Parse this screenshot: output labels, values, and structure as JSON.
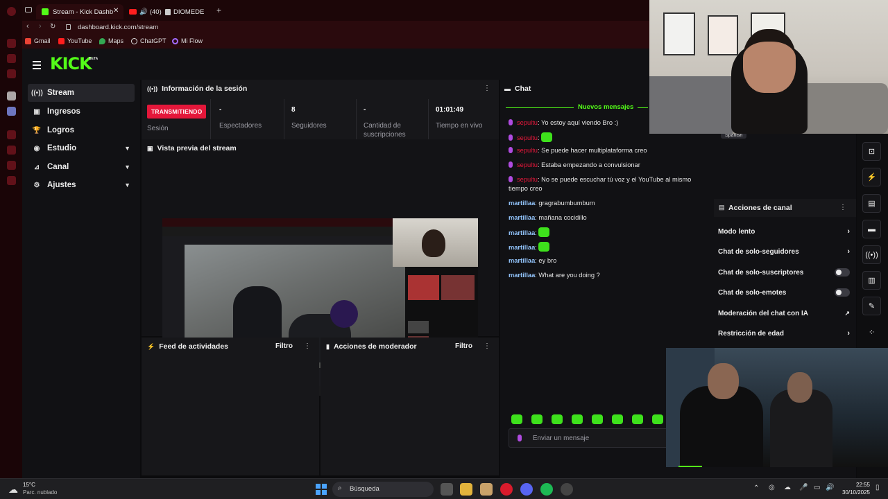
{
  "browser": {
    "tabs": [
      {
        "title": "Stream - Kick Dashb",
        "active": true
      },
      {
        "title": "(40)",
        "active": false
      },
      {
        "title": "DIOMEDE",
        "active": false
      }
    ],
    "url": "dashboard.kick.com/stream",
    "bookmarks": [
      "Gmail",
      "YouTube",
      "Maps",
      "ChatGPT",
      "Mi Flow"
    ]
  },
  "kick": {
    "logo": "KICK",
    "beta": "BETA",
    "brand_color": "#53fc18",
    "nav": [
      {
        "label": "Stream",
        "icon": "broadcast-icon",
        "active": true,
        "expandable": false
      },
      {
        "label": "Ingresos",
        "icon": "wallet-icon",
        "active": false,
        "expandable": false
      },
      {
        "label": "Logros",
        "icon": "trophy-icon",
        "active": false,
        "expandable": false
      },
      {
        "label": "Estudio",
        "icon": "studio-icon",
        "active": false,
        "expandable": true
      },
      {
        "label": "Canal",
        "icon": "channel-icon",
        "active": false,
        "expandable": true
      },
      {
        "label": "Ajustes",
        "icon": "gear-icon",
        "active": false,
        "expandable": true
      }
    ]
  },
  "session": {
    "title": "Información de la sesión",
    "status_badge": "TRANSMITIENDO",
    "status_label": "Sesión",
    "stats": [
      {
        "value": "-",
        "label": "Espectadores"
      },
      {
        "value": "8",
        "label": "Seguidores"
      },
      {
        "value": "-",
        "label": "Cantidad de suscripciones"
      },
      {
        "value": "01:01:49",
        "label": "Tiempo en vivo"
      }
    ]
  },
  "preview": {
    "title": "Vista previa del stream"
  },
  "activity": {
    "title": "Feed de actividades",
    "filter": "Filtro"
  },
  "moderator": {
    "title": "Acciones de moderador",
    "filter": "Filtro"
  },
  "chat": {
    "title": "Chat",
    "new_messages": "Nuevos mensajes",
    "messages": [
      {
        "user": "sepultu",
        "text": "Yo estoy aquí viendo Bro :)",
        "style": "sep",
        "emote": false
      },
      {
        "user": "sepultu",
        "text": "",
        "style": "sep",
        "emote": true
      },
      {
        "user": "sepultu",
        "text": "Se puede hacer multiplataforma creo",
        "style": "sep",
        "emote": false
      },
      {
        "user": "sepultu",
        "text": "Estaba empezando a convulsionar",
        "style": "sep",
        "emote": false
      },
      {
        "user": "sepultu",
        "text": "No se puede escuchar tú voz y el YouTube al mismo tiempo creo",
        "style": "sep",
        "emote": false
      },
      {
        "user": "martillaa",
        "text": "gragrabumbumbum",
        "style": "mar",
        "emote": false
      },
      {
        "user": "martillaa",
        "text": "mañana cocidillo",
        "style": "mar",
        "emote": false
      },
      {
        "user": "martillaa",
        "text": "",
        "style": "mar",
        "emote": true
      },
      {
        "user": "martillaa",
        "text": "",
        "style": "mar",
        "emote": true
      },
      {
        "user": "martillaa",
        "text": "ey bro",
        "style": "mar",
        "emote": false
      },
      {
        "user": "martillaa",
        "text": "What are you doing ?",
        "style": "mar",
        "emote": false
      }
    ],
    "input_placeholder": "Enviar un mensaje"
  },
  "channel_actions": {
    "language_tag": "Spanish",
    "title": "Acciones de canal",
    "items": [
      {
        "label": "Modo lento",
        "control": "chevron"
      },
      {
        "label": "Chat de solo-seguidores",
        "control": "chevron"
      },
      {
        "label": "Chat de solo-suscriptores",
        "control": "toggle"
      },
      {
        "label": "Chat de solo-emotes",
        "control": "toggle"
      },
      {
        "label": "Moderación del chat con IA",
        "control": "external"
      },
      {
        "label": "Restricción de edad",
        "control": "chevron"
      }
    ]
  },
  "rail_icons": [
    "scan-icon",
    "bolt-icon",
    "clipboard-icon",
    "chat-bubble-icon",
    "signal-icon",
    "layout-icon",
    "wrench-icon",
    "apps-icon"
  ],
  "taskbar": {
    "weather_temp": "15°C",
    "weather_desc": "Parc. nublado",
    "search": "Búsqueda",
    "time": "22:55",
    "date": "30/10/2025"
  }
}
